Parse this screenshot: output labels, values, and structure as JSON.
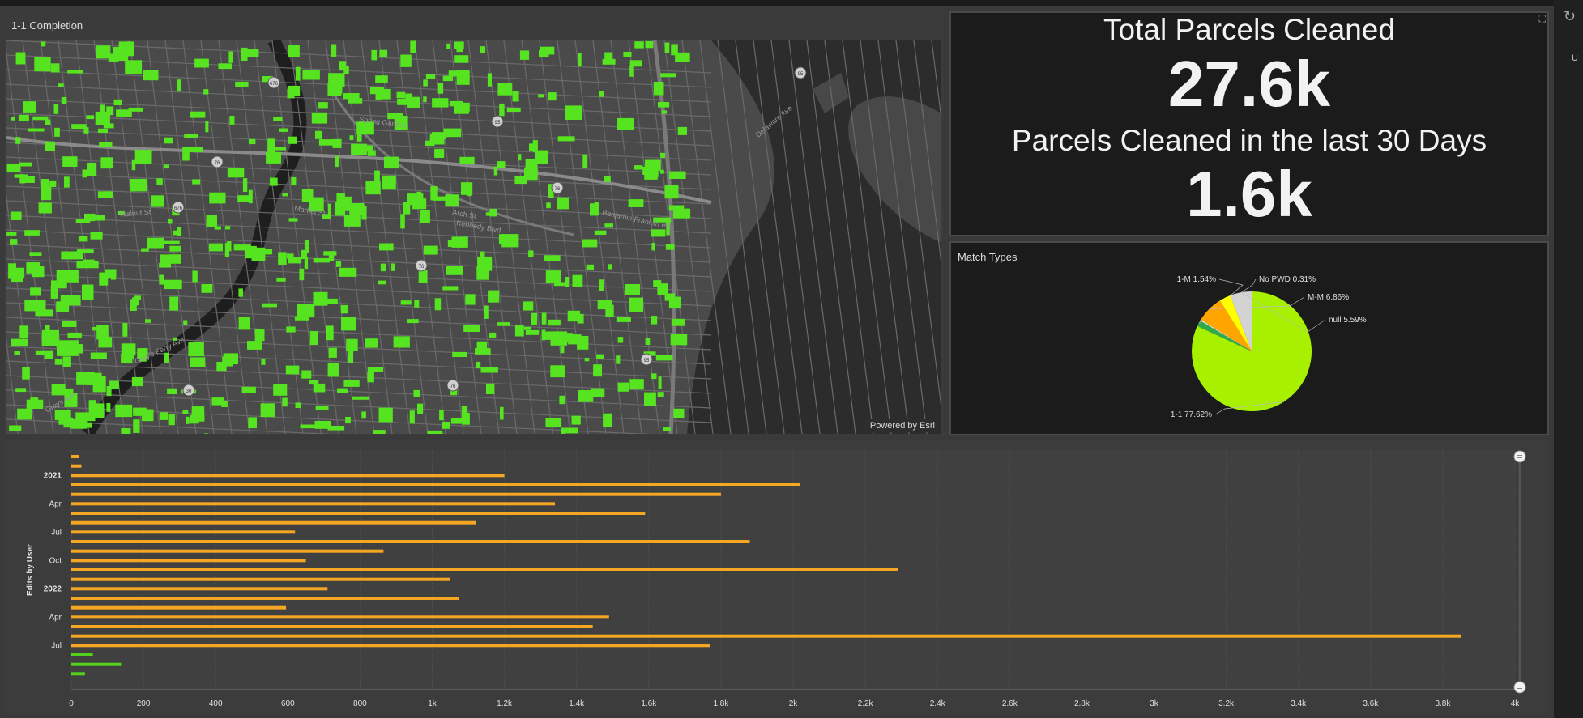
{
  "map_panel": {
    "title": "1-1 Completion",
    "attribution": "Powered by Esri",
    "street_labels": [
      "Spring Garden",
      "Market St",
      "Walnut St",
      "Arch St",
      "Kennedy Blvd",
      "Benjamin Franklin Bri",
      "Gray's Ferry Ave",
      "Delaware Ave",
      "Grays Ave"
    ],
    "shield_labels": [
      "676",
      "95",
      "76",
      "676",
      "76",
      "95",
      "30",
      "76",
      "95",
      "76"
    ],
    "colors": {
      "background": "#4a4a4a",
      "parcels": "#55e41f",
      "river": "#1e1e1e",
      "streets": "#6a6a6a"
    }
  },
  "indicators": {
    "total_title": "Total Parcels Cleaned",
    "total_value": "27.6k",
    "recent_title": "Parcels Cleaned in the last 30 Days",
    "recent_value": "1.6k"
  },
  "pie_panel": {
    "title": "Match Types"
  },
  "bar_panel": {
    "title": "Edits by User"
  },
  "window": {
    "side_glyph": "↻",
    "side_letter": "U"
  },
  "chart_data": [
    {
      "type": "pie",
      "title": "Match Types",
      "slices": [
        {
          "label": "1-1 77.62%",
          "name": "1-1",
          "value": 77.62,
          "color": "#a6f000"
        },
        {
          "label": "1-M 1.54%",
          "name": "1-M",
          "value": 1.54,
          "color": "#2faa4a"
        },
        {
          "label": "No PWD 0.31%",
          "name": "No PWD",
          "value": 0.31,
          "color": "#e8e8e8"
        },
        {
          "label": "M-M 6.86%",
          "name": "M-M",
          "value": 6.86,
          "color": "#ffa500"
        },
        {
          "label": "",
          "name": "",
          "value": 2.9,
          "color": "#ffff00"
        },
        {
          "label": "null 5.59%",
          "name": "null",
          "value": 5.59,
          "color": "#d3d3d3"
        }
      ]
    },
    {
      "type": "bar",
      "orientation": "horizontal",
      "ylabel": "Edits by User",
      "xlim": [
        0,
        4000
      ],
      "x_ticks": [
        "0",
        "200",
        "400",
        "600",
        "800",
        "1k",
        "1.2k",
        "1.4k",
        "1.6k",
        "1.8k",
        "2k",
        "2.2k",
        "2.4k",
        "2.6k",
        "2.8k",
        "3k",
        "3.2k",
        "3.4k",
        "3.6k",
        "3.8k",
        "4k"
      ],
      "y_ticks": [
        {
          "label": "2021",
          "bold": true,
          "row": 2
        },
        {
          "label": "Apr",
          "bold": false,
          "row": 5
        },
        {
          "label": "Jul",
          "bold": false,
          "row": 8
        },
        {
          "label": "Oct",
          "bold": false,
          "row": 11
        },
        {
          "label": "2022",
          "bold": true,
          "row": 14
        },
        {
          "label": "Apr",
          "bold": false,
          "row": 17
        },
        {
          "label": "Jul",
          "bold": false,
          "row": 20
        }
      ],
      "series": [
        {
          "color": "#f5a623",
          "values": [
            22,
            28,
            1200,
            2020,
            1800,
            1340,
            1590,
            1120,
            620,
            1880,
            865,
            650,
            2290,
            1050,
            710,
            1075,
            595,
            1490,
            1445,
            3850,
            1770,
            0,
            0,
            0
          ]
        },
        {
          "color": "#55d11d",
          "values": [
            0,
            0,
            0,
            0,
            0,
            0,
            0,
            0,
            0,
            0,
            0,
            0,
            0,
            0,
            0,
            0,
            0,
            0,
            0,
            0,
            0,
            60,
            138,
            38
          ]
        }
      ]
    }
  ]
}
